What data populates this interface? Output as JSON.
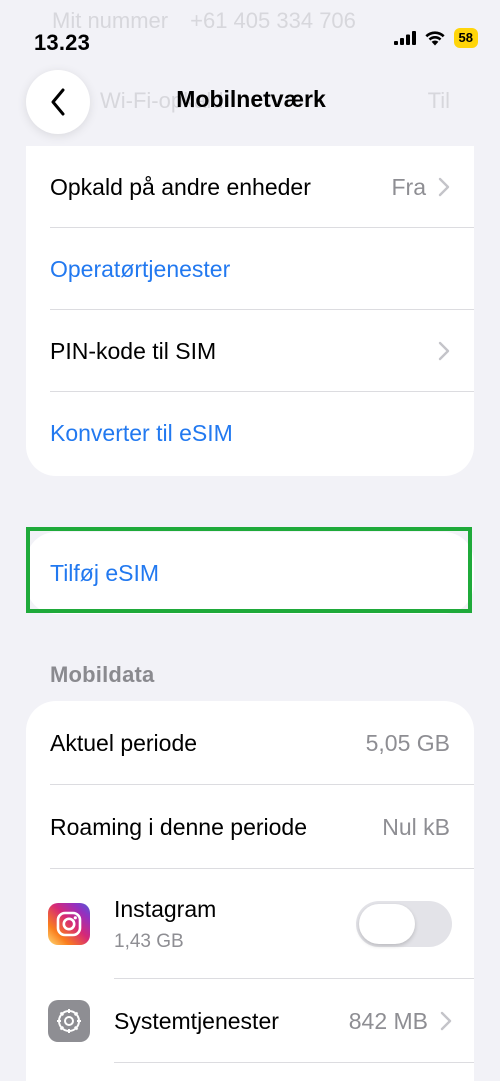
{
  "status_bar": {
    "time": "13.23",
    "battery": "58",
    "ghost_label": "Mit nummer",
    "ghost_value": "+61 405 334 706"
  },
  "nav": {
    "title": "Mobilnetværk",
    "ghost_label": "Wi-Fi-opkald",
    "ghost_value": "Til"
  },
  "group1": {
    "rows": [
      {
        "label": "Opkald på andre enheder",
        "value": "Fra"
      },
      {
        "label": "Operatørtjenester"
      },
      {
        "label": "PIN-kode til SIM"
      },
      {
        "label": "Konverter til eSIM"
      }
    ]
  },
  "add_esim": {
    "label": "Tilføj eSIM",
    "highlight_color": "#1faa3a"
  },
  "mobile_data": {
    "header": "Mobildata",
    "rows": [
      {
        "label": "Aktuel periode",
        "value": "5,05 GB"
      },
      {
        "label": "Roaming i denne periode",
        "value": "Nul kB"
      }
    ],
    "apps": [
      {
        "name": "Instagram",
        "usage": "1,43 GB",
        "enabled": false,
        "icon": "instagram-icon"
      },
      {
        "name": "Systemtjenester",
        "value": "842 MB",
        "icon": "gear-icon"
      }
    ]
  },
  "colors": {
    "accent": "#2279f0",
    "background": "#f2f2f7",
    "secondary_text": "#8e8e93"
  }
}
